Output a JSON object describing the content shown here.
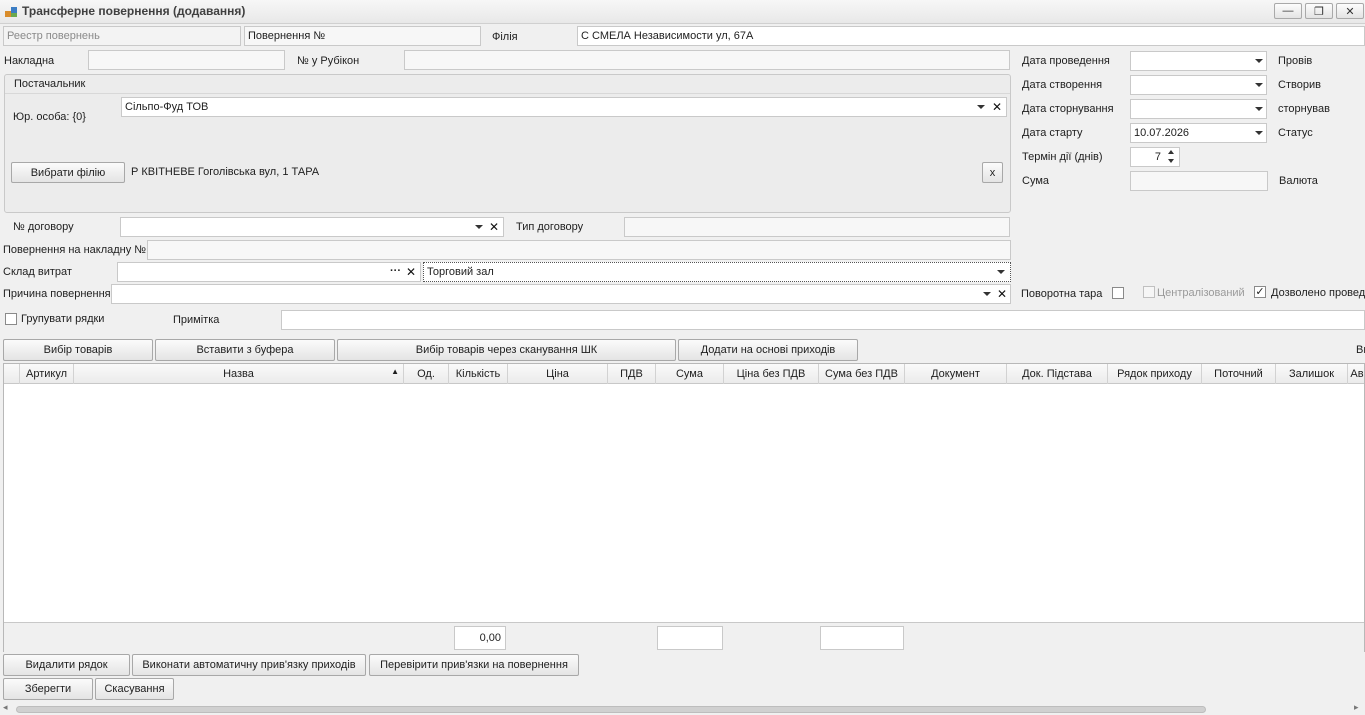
{
  "window": {
    "title": "Трансферне повернення (додавання)",
    "controls": {
      "minimize": "—",
      "restore": "❐",
      "close": "✕"
    }
  },
  "header": {
    "registry_placeholder": "Реестр повернень",
    "return_no_label": "Повернення №",
    "branch_label": "Філія",
    "branch_value": "С СМЕЛА Независимости ул, 67А"
  },
  "invoice": {
    "invoice_label": "Накладна",
    "invoice_value": "",
    "rubicon_label": "№ у Рубікон",
    "rubicon_value": ""
  },
  "supplier": {
    "group_label": "Постачальник",
    "legal_label": "Юр. особа: {0}",
    "legal_value": "Сільпо-Фуд ТОВ",
    "choose_branch_button": "Вибрати філію",
    "branch_text": "Р КВІТНЕВЕ Гоголівська вул, 1 ТАРА",
    "clear_button": "x"
  },
  "dates": {
    "posted_label": "Дата проведення",
    "posted_value": "",
    "posted_by_label": "Провів",
    "created_label": "Дата створення",
    "created_value": "",
    "created_by_label": "Створив",
    "reversed_label": "Дата сторнування",
    "reversed_value": "",
    "reversed_by_label": "сторнував",
    "start_label": "Дата старту",
    "start_value": "10.07.2026",
    "status_label": "Статус",
    "term_label": "Термін дії (днів)",
    "term_value": "7",
    "sum_label": "Сума",
    "sum_value": "",
    "currency_label": "Валюта"
  },
  "contract": {
    "number_label": "№ договору",
    "number_value": "",
    "type_label": "Тип договору",
    "type_value": ""
  },
  "return_invoice": {
    "label": "Повернення на накладну №",
    "value": ""
  },
  "expense_warehouse": {
    "label": "Склад витрат",
    "value": "",
    "hall_value": "Торговий зал",
    "ellipsis": "···"
  },
  "reason": {
    "label": "Причина повернення",
    "value": ""
  },
  "options": {
    "returnable_tare_label": "Поворотна тара",
    "returnable_tare_checked": false,
    "centralized_label": "Централізований",
    "centralized_checked": false,
    "allowed_label": "Дозволено провед",
    "allowed_checked": true,
    "group_rows_label": "Групувати рядки",
    "group_rows_checked": false,
    "note_label": "Примітка",
    "note_value": ""
  },
  "toolbar": {
    "select_goods": "Вибір товарів",
    "paste_clipboard": "Вставити з буфера",
    "scan_select": "Вибір товарів через сканування ШК",
    "add_from_receipts": "Додати на основі приходів",
    "right_cut": "Ви"
  },
  "grid": {
    "columns": [
      "Артикул",
      "Назва",
      "Од.",
      "Кількість",
      "Ціна",
      "ПДВ",
      "Сума",
      "Ціна без ПДВ",
      "Сума без ПДВ",
      "Документ",
      "Док. Підстава",
      "Рядок приходу",
      "Поточний",
      "Залишок",
      "Ав"
    ],
    "rows": [],
    "footer_quantity_total": "0,00",
    "footer_sum_total": "",
    "footer_sum_no_vat_total": ""
  },
  "actions": {
    "delete_row": "Видалити рядок",
    "auto_link": "Виконати автоматичну прив'язку приходів",
    "check_links": "Перевірити прив'язки на повернення",
    "save": "Зберегти",
    "cancel": "Скасування"
  }
}
